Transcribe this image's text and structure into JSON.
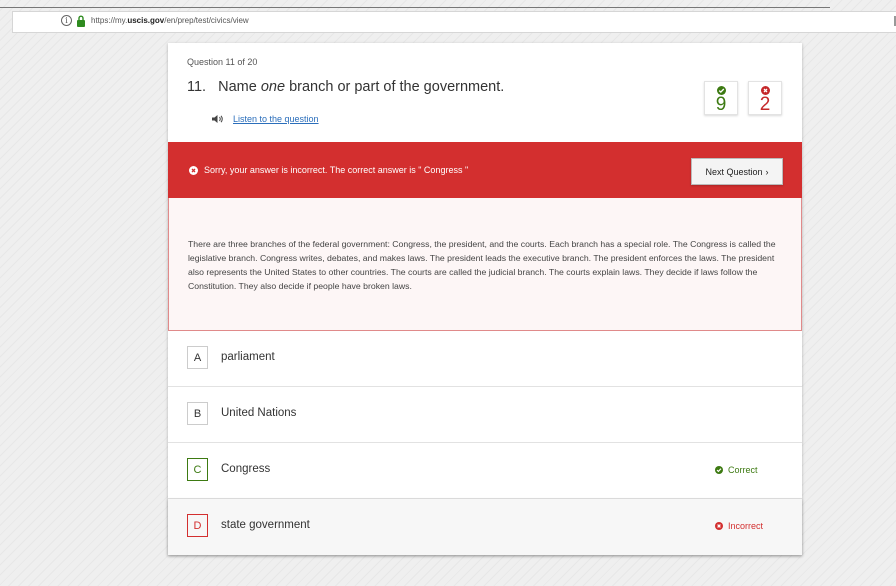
{
  "browser": {
    "url_prefix": "https://my.",
    "url_domain": "uscis.gov",
    "url_path": "/en/prep/test/civics/view",
    "info_glyph": "i"
  },
  "question": {
    "counter": "Question 11 of 20",
    "number": "11.",
    "text_before": "Name",
    "text_emphasis": "one",
    "text_after": "branch or part of the government.",
    "listen_label": "Listen to the question"
  },
  "score": {
    "correct_count": "9",
    "incorrect_count": "2"
  },
  "feedback": {
    "message": "Sorry, your answer is incorrect. The correct answer is \" Congress \"",
    "next_label": "Next Question",
    "explanation": "There are three branches of the federal government: Congress, the president, and the courts. Each branch has a special role. The Congress is called the legislative branch. Congress writes, debates, and makes laws. The president leads the executive branch. The president enforces the laws. The president also represents the United States to other countries. The courts are called the judicial branch. The courts explain laws. They decide if laws follow the Constitution. They also decide if people have broken laws."
  },
  "answers": [
    {
      "letter": "A",
      "text": "parliament",
      "verdict": ""
    },
    {
      "letter": "B",
      "text": "United Nations",
      "verdict": ""
    },
    {
      "letter": "C",
      "text": "Congress",
      "verdict": "Correct"
    },
    {
      "letter": "D",
      "text": "state government",
      "verdict": "Incorrect"
    }
  ],
  "colors": {
    "correct": "#3d7a12",
    "incorrect": "#d32f2f",
    "link": "#2a6ebb"
  },
  "icons": {
    "info": "info-icon",
    "lock": "lock-icon",
    "speaker": "speaker-icon",
    "check": "check-circle-icon",
    "cross": "x-circle-icon",
    "chevron": "chevron-right-icon"
  }
}
